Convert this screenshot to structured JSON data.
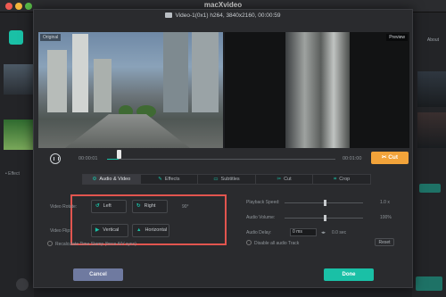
{
  "app": {
    "title": "macXvideo"
  },
  "sidebar": {
    "effect_label": "• Effect",
    "about": "About"
  },
  "dialog": {
    "video_info": "Video-1(0x1) h264, 3840x2160, 00:00:59",
    "preview": {
      "original_tag": "Original",
      "preview_tag": "Preview"
    },
    "timeline": {
      "current_time": "00:00:01",
      "end_time": "00:01:00",
      "progress": 0.05,
      "cut_label": "Cut"
    },
    "tabs": [
      {
        "label": "Audio & Video",
        "icon": "audio-video-icon",
        "active": true
      },
      {
        "label": "Effects",
        "icon": "effects-icon",
        "active": false
      },
      {
        "label": "Subtitles",
        "icon": "subtitles-icon",
        "active": false
      },
      {
        "label": "Cut",
        "icon": "scissors-icon",
        "active": false
      },
      {
        "label": "Crop",
        "icon": "crop-icon",
        "active": false
      }
    ],
    "video": {
      "rotate_label": "Video Rotate:",
      "rotate_left": "Left",
      "rotate_right": "Right",
      "rotate_degrees": "90°",
      "flip_label": "Video Flip:",
      "flip_vertical": "Vertical",
      "flip_horizontal": "Horizontal",
      "recalc_label": "Recalculate Time Stamp (force A/V sync)"
    },
    "audio": {
      "speed_label": "Playback Speed:",
      "speed_value": "1.0 x",
      "speed_level": 0.5,
      "volume_label": "Audio Volume:",
      "volume_value": "100%",
      "volume_level": 0.5,
      "delay_label": "Audio Delay:",
      "delay_value": "0 ms",
      "delay_unit": "0.0 sec",
      "disable_label": "Disable all audio Track",
      "reset_label": "Reset"
    },
    "cancel_label": "Cancel",
    "done_label": "Done"
  }
}
